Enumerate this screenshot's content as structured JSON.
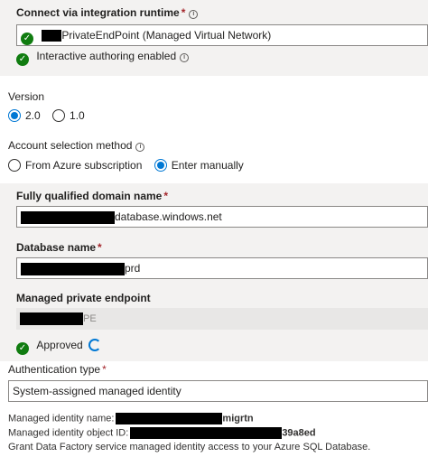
{
  "runtime": {
    "label": "Connect via integration runtime",
    "required_mark": "*",
    "value": "PrivateEndPoint (Managed Virtual Network)",
    "status_text": "Interactive authoring enabled"
  },
  "version": {
    "label": "Version",
    "options": [
      {
        "label": "2.0",
        "selected": true
      },
      {
        "label": "1.0",
        "selected": false
      }
    ]
  },
  "account_method": {
    "label": "Account selection method",
    "options": [
      {
        "label": "From Azure subscription",
        "selected": false
      },
      {
        "label": "Enter manually",
        "selected": true
      }
    ]
  },
  "fqdn": {
    "label": "Fully qualified domain name",
    "required_mark": "*",
    "value_suffix": "database.windows.net"
  },
  "database": {
    "label": "Database name",
    "required_mark": "*",
    "value_suffix": "prd"
  },
  "mpe": {
    "label": "Managed private endpoint",
    "value_suffix": "PE",
    "status_text": "Approved"
  },
  "auth": {
    "label": "Authentication type",
    "required_mark": "*",
    "value": "System-assigned managed identity"
  },
  "identity": {
    "name_label": "Managed identity name:",
    "name_suffix": "migrtn",
    "object_label": "Managed identity object ID:",
    "object_suffix": "39a8ed",
    "grant_text": "Grant Data Factory service managed identity access to your Azure SQL Database."
  },
  "colors": {
    "accent": "#0078d4",
    "success": "#107c10",
    "required": "#a4262c",
    "panel": "#f3f2f1"
  }
}
